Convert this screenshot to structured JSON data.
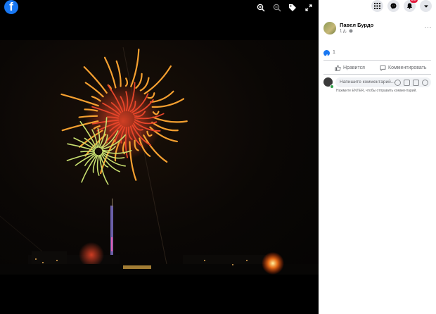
{
  "viewer": {
    "logo_letter": "f",
    "tools": [
      "zoom-in-icon",
      "zoom-out-icon",
      "tag-icon",
      "fullscreen-icon"
    ]
  },
  "topbar": {
    "notifications_badge": "20"
  },
  "post": {
    "author": "Павел Бурдо",
    "time": "1 д.",
    "privacy_icon": "globe-icon",
    "more": "···",
    "reactions_count": "1",
    "like_label": "Нравится",
    "comment_label": "Комментировать"
  },
  "comment": {
    "placeholder": "Напишите комментарий...",
    "hint": "Нажмите ENTER, чтобы отправить комментарий."
  },
  "colors": {
    "brand": "#1877f2",
    "badge": "#e41e3f",
    "online": "#31a24c"
  }
}
